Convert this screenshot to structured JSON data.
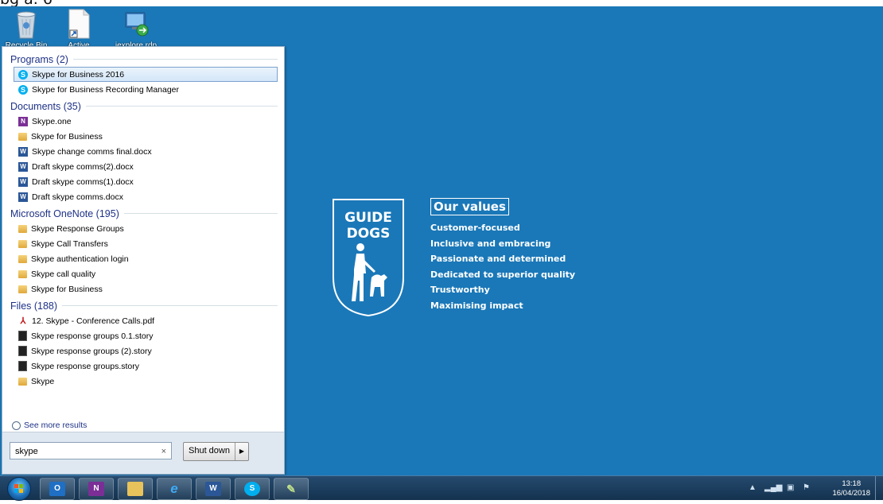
{
  "top_cutoff_text": "bg a. 6",
  "desktop_icons": [
    {
      "label": "Recycle Bin",
      "icon": "recycle-bin-icon"
    },
    {
      "label": "Active",
      "icon": "file-shortcut-icon"
    },
    {
      "label": "iexplore.rdp",
      "icon": "remote-desktop-icon"
    }
  ],
  "start_menu": {
    "sections": [
      {
        "header": "Programs (2)",
        "items": [
          {
            "label": "Skype for Business 2016",
            "icon": "skype-icon",
            "selected": true
          },
          {
            "label": "Skype for Business Recording Manager",
            "icon": "skype-icon"
          }
        ]
      },
      {
        "header": "Documents (35)",
        "items": [
          {
            "label": "Skype.one",
            "icon": "onenote-icon"
          },
          {
            "label": "Skype for Business",
            "icon": "folder-icon"
          },
          {
            "label": "Skype change comms final.docx",
            "icon": "word-doc-icon"
          },
          {
            "label": "Draft skype comms(2).docx",
            "icon": "word-doc-icon"
          },
          {
            "label": "Draft skype comms(1).docx",
            "icon": "word-doc-icon"
          },
          {
            "label": "Draft skype comms.docx",
            "icon": "word-doc-icon"
          }
        ]
      },
      {
        "header": "Microsoft OneNote (195)",
        "items": [
          {
            "label": "Skype Response Groups",
            "icon": "folder-icon"
          },
          {
            "label": "Skype Call Transfers",
            "icon": "folder-icon"
          },
          {
            "label": "Skype authentication login",
            "icon": "folder-icon"
          },
          {
            "label": "Skype call quality",
            "icon": "folder-icon"
          },
          {
            "label": "Skype for Business",
            "icon": "folder-icon"
          }
        ]
      },
      {
        "header": "Files (188)",
        "items": [
          {
            "label": "12. Skype - Conference Calls.pdf",
            "icon": "pdf-icon"
          },
          {
            "label": "Skype response groups 0.1.story",
            "icon": "story-file-icon"
          },
          {
            "label": "Skype response groups (2).story",
            "icon": "story-file-icon"
          },
          {
            "label": "Skype response groups.story",
            "icon": "story-file-icon"
          },
          {
            "label": "Skype",
            "icon": "folder-icon"
          }
        ]
      }
    ],
    "see_more": "See more results",
    "search_value": "skype",
    "clear_glyph": "×",
    "shutdown_label": "Shut down",
    "shutdown_arrow": "▶"
  },
  "wallpaper": {
    "logo_line1": "GUIDE",
    "logo_line2": "DOGS",
    "values_header": "Our values",
    "values": [
      "Customer-focused",
      "Inclusive and embracing",
      "Passionate and determined",
      "Dedicated to superior quality",
      "Trustworthy",
      "Maximising impact"
    ]
  },
  "taskbar": {
    "apps": [
      {
        "name": "outlook",
        "glyph": "O",
        "color": "#1f6fc4"
      },
      {
        "name": "onenote",
        "glyph": "N",
        "color": "#7b2f96"
      },
      {
        "name": "file-explorer",
        "glyph": "",
        "color": "#e8c25a"
      },
      {
        "name": "internet-explorer",
        "glyph": "e",
        "color": "#2a8fe0"
      },
      {
        "name": "word",
        "glyph": "W",
        "color": "#2b5797"
      },
      {
        "name": "skype",
        "glyph": "S",
        "color": "#00aff0"
      },
      {
        "name": "paint",
        "glyph": "✎",
        "color": "#8ab04a"
      }
    ],
    "time": "13:18",
    "date": "16/04/2018"
  }
}
